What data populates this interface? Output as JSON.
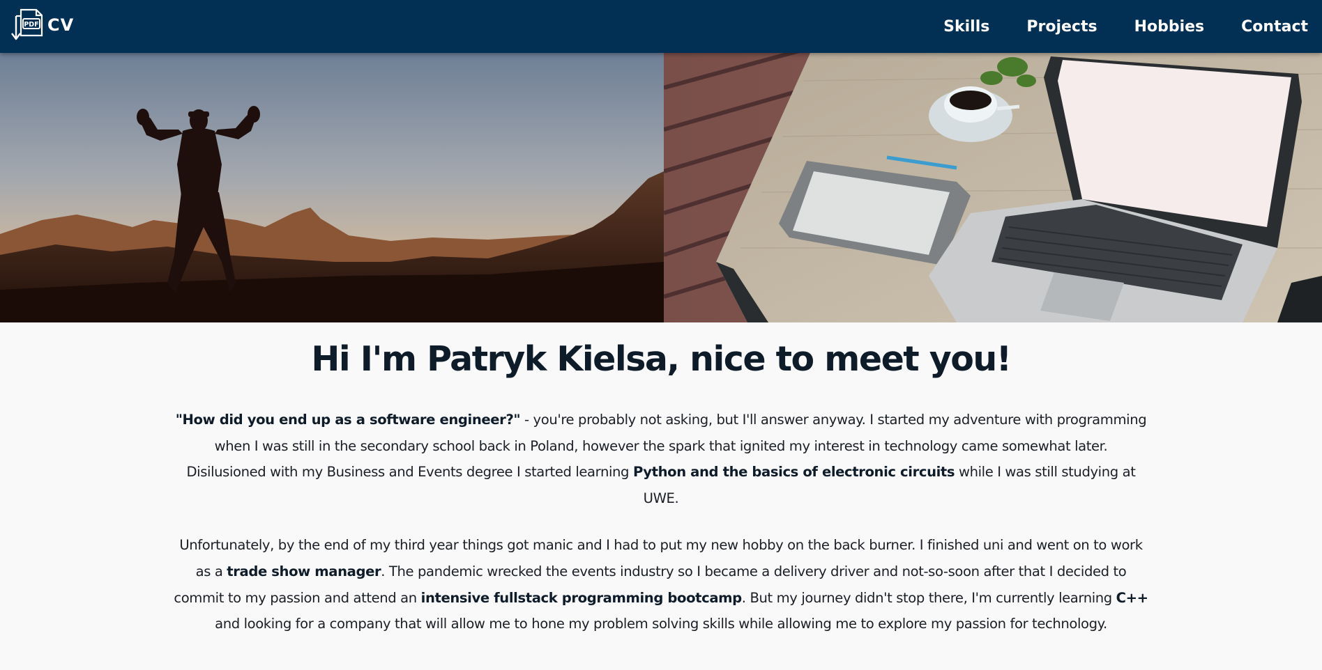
{
  "nav": {
    "logo_icon_label": "PDF",
    "logo_text": "CV",
    "links": [
      "Skills",
      "Projects",
      "Hobbies",
      "Contact"
    ]
  },
  "hero": {
    "left_image": "person-silhouette-mountains-photo",
    "right_image": "laptop-desk-photo"
  },
  "main": {
    "heading": "Hi I'm Patryk Kielsa, nice to meet you!",
    "p1": {
      "s1": "\"How did you end up as a software engineer?\"",
      "s2": " - you're probably not asking, but I'll answer anyway. I started my adventure with programming when I was still in the secondary school back in Poland, however the spark that ignited my interest in technology came somewhat later. Disilusioned with my Business and Events degree I started learning ",
      "s3": "Python and the basics of electronic circuits",
      "s4": " while I was still studying at UWE."
    },
    "p2": {
      "s1": "Unfortunately, by the end of my third year things got manic and I had to put my new hobby on the back burner. I finished uni and went on to work as a ",
      "s2": "trade show manager",
      "s3": ". The pandemic wrecked the events industry so I became a delivery driver and not-so-soon after that I decided to commit to my passion and attend an ",
      "s4": "intensive fullstack programming bootcamp",
      "s5": ". But my journey didn't stop there, I'm currently learning ",
      "s6": "C++",
      "s7": " and looking for a company that will allow me to hone my problem solving skills while allowing me to explore my passion for technology."
    }
  },
  "colors": {
    "navbar": "#023054",
    "background": "#f9f9f9",
    "text": "#0e1b29"
  }
}
